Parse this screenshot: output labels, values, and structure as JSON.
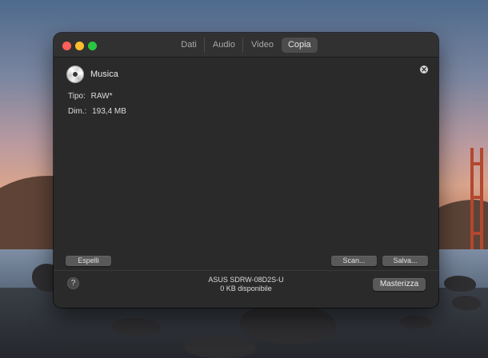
{
  "window": {
    "tabs": [
      {
        "label": "Dati",
        "active": false
      },
      {
        "label": "Audio",
        "active": false
      },
      {
        "label": "Video",
        "active": false
      },
      {
        "label": "Copia",
        "active": true
      }
    ]
  },
  "disc": {
    "title": "Musica",
    "icon": "cd-disc-icon",
    "type_label": "Tipo:",
    "type_value": "RAW*",
    "size_label": "Dim.:",
    "size_value": "193,4 MB"
  },
  "buttons": {
    "eject": "Espelli",
    "scan": "Scan...",
    "save": "Salva...",
    "burn": "Masterizza",
    "help": "?"
  },
  "drive": {
    "name": "ASUS SDRW-08D2S-U",
    "available": "0 KB disponibile"
  },
  "colors": {
    "close": "#fe5f57",
    "minimize": "#febc2e",
    "maximize": "#28c840",
    "window_bg": "#2b2a2a"
  }
}
